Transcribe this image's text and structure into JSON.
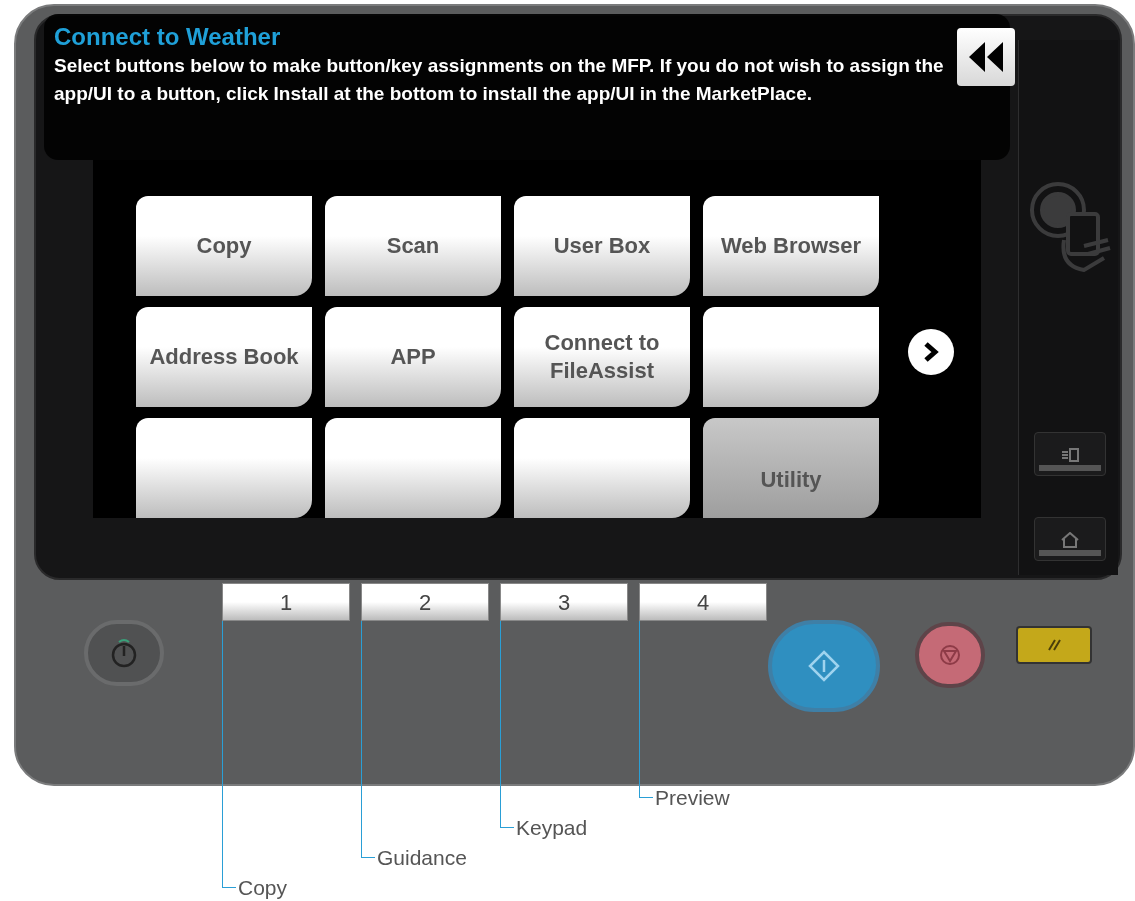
{
  "header": {
    "title": "Connect to Weather",
    "instructions": "Select buttons below to make button/key assignments on the MFP. If you do not wish to assign the app/UI to a button, click Install at the bottom to install the app/UI in the MarketPlace."
  },
  "tiles": [
    {
      "kind": "app",
      "label": "Copy"
    },
    {
      "kind": "app",
      "label": "Scan"
    },
    {
      "kind": "app",
      "label": "User Box"
    },
    {
      "kind": "app",
      "label": "Web Browser"
    },
    {
      "kind": "app",
      "label": "Address Book"
    },
    {
      "kind": "app",
      "label": "APP"
    },
    {
      "kind": "app",
      "label": "Connect to FileAssist"
    },
    {
      "kind": "empty"
    },
    {
      "kind": "empty"
    },
    {
      "kind": "empty"
    },
    {
      "kind": "empty"
    },
    {
      "kind": "system",
      "label": "Utility"
    }
  ],
  "hardware_keys": [
    {
      "label": "1",
      "callout": "Copy"
    },
    {
      "label": "2",
      "callout": "Guidance"
    },
    {
      "label": "3",
      "callout": "Keypad"
    },
    {
      "label": "4",
      "callout": "Preview"
    }
  ]
}
